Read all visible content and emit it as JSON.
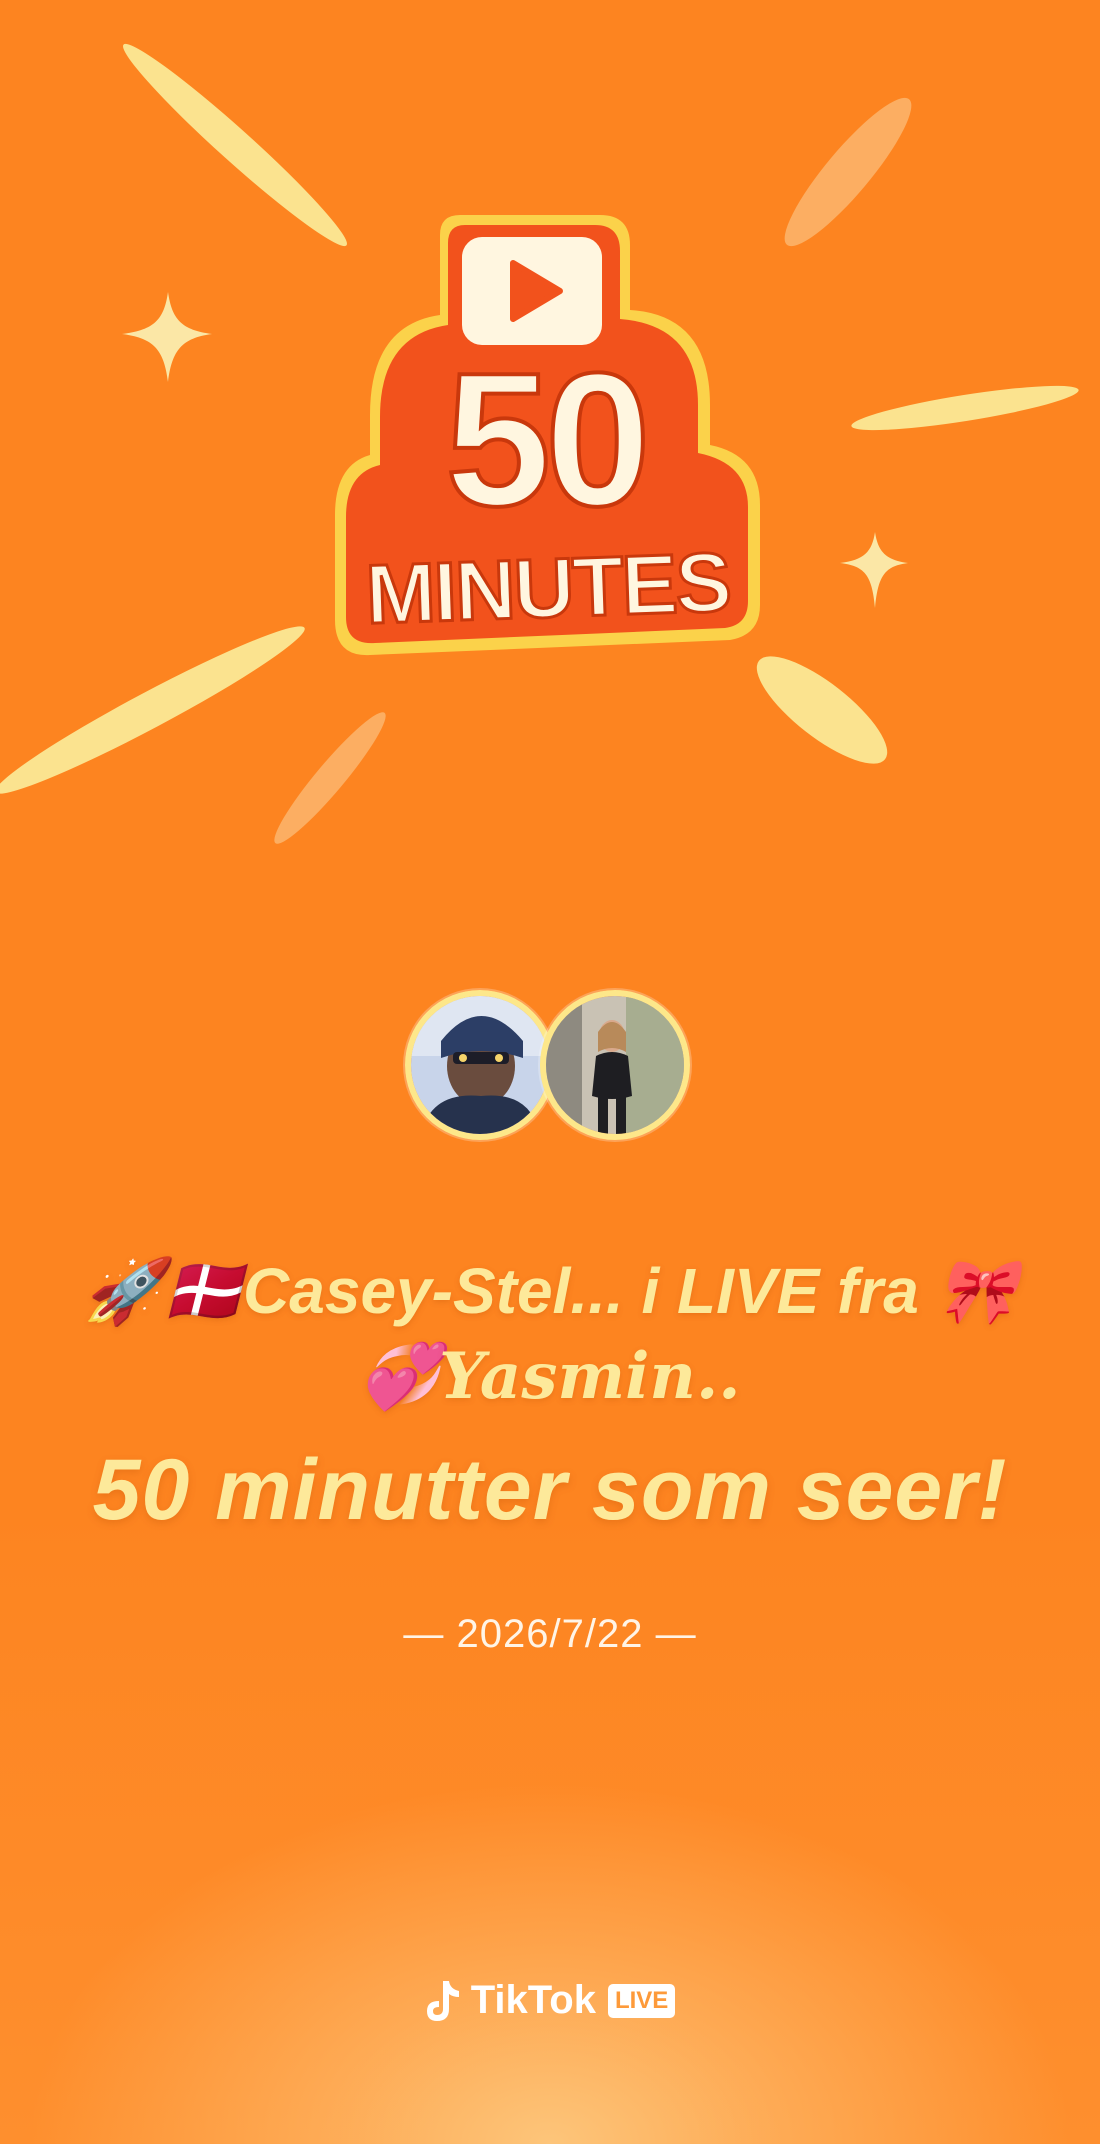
{
  "badge": {
    "number": "50",
    "word": "MINUTES"
  },
  "headline": {
    "line1_icons": "🚀🇩🇰",
    "line1_text": "Casey-Stel... i LIVE fra ",
    "line1_end_icon": "🎀",
    "line2_icon": "💞",
    "line2_text": "Yasmin.."
  },
  "subhead": "50 minutter som seer!",
  "date": "— 2026/7/22 —",
  "brand": {
    "name": "TikTok",
    "tag": "LIVE"
  },
  "colors": {
    "background": "#fd8420",
    "text_yellow": "#fde99a",
    "badge_red": "#f2521c",
    "badge_cream": "#fff6e0"
  },
  "icons": [
    "play-icon",
    "sparkle-icon",
    "music-note-icon"
  ]
}
